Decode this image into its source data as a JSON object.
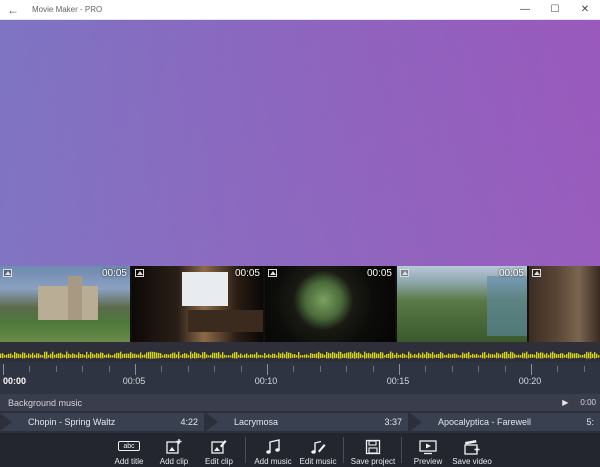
{
  "window": {
    "title": "Movie Maker - PRO",
    "back_icon": "back-arrow-icon",
    "minimize": "—",
    "maximize": "☐",
    "close": "✕"
  },
  "clips": [
    {
      "duration": "00:05"
    },
    {
      "duration": "00:05"
    },
    {
      "duration": "00:05"
    },
    {
      "duration": "00:05"
    },
    {
      "duration": ""
    }
  ],
  "ruler": {
    "labels": [
      "00:00",
      "00:05",
      "00:10",
      "00:15",
      "00:20"
    ]
  },
  "background_music": {
    "label": "Background music",
    "play_icon": "▶",
    "time": "0:00"
  },
  "tracks": [
    {
      "name": "Chopin - Spring Waltz",
      "length": "4:22"
    },
    {
      "name": "Lacrymosa",
      "length": "3:37"
    },
    {
      "name": "Apocalyptica - Farewell",
      "length": "5:"
    }
  ],
  "toolbar": {
    "add_title": "Add title",
    "add_title_glyph": "abc",
    "add_clip": "Add clip",
    "edit_clip": "Edit clip",
    "add_music": "Add music",
    "edit_music": "Edit music",
    "save_project": "Save project",
    "preview": "Preview",
    "save_video": "Save video"
  },
  "colors": {
    "waveform": "#d4d41a",
    "preview_left": "#7f75c1",
    "preview_right": "#a351ba"
  }
}
